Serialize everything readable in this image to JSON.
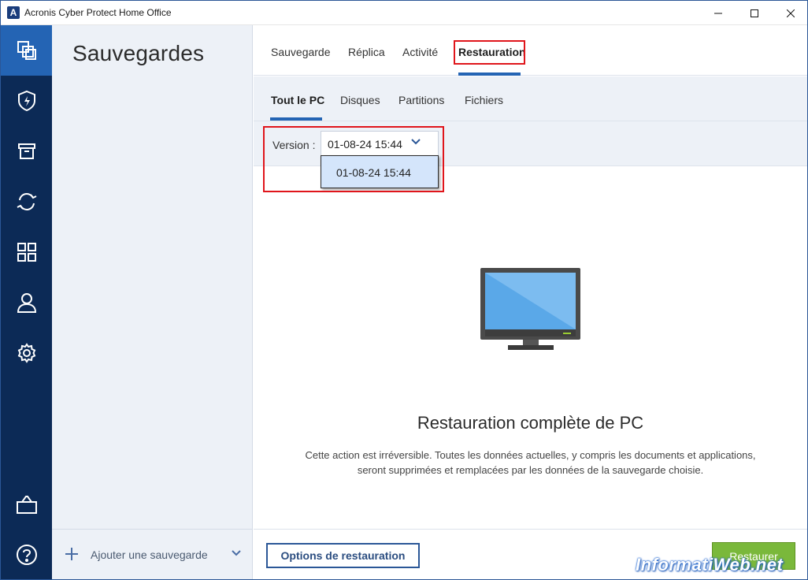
{
  "window": {
    "title": "Acronis Cyber Protect Home Office",
    "app_icon_letter": "A"
  },
  "rail": {
    "items": [
      {
        "icon": "backup-copies-icon",
        "active": true
      },
      {
        "icon": "shield-icon",
        "active": false
      },
      {
        "icon": "archive-icon",
        "active": false
      },
      {
        "icon": "sync-icon",
        "active": false
      },
      {
        "icon": "dashboard-grid-icon",
        "active": false
      },
      {
        "icon": "account-icon",
        "active": false
      },
      {
        "icon": "gear-icon",
        "active": false
      },
      {
        "icon": "shop-bag-icon",
        "active": false
      },
      {
        "icon": "help-icon",
        "active": false
      }
    ]
  },
  "sidebar": {
    "title": "Sauvegardes",
    "add_label": "Ajouter une sauvegarde"
  },
  "top_tabs": [
    {
      "label": "Sauvegarde",
      "active": false
    },
    {
      "label": "Réplica",
      "active": false
    },
    {
      "label": "Activité",
      "active": false
    },
    {
      "label": "Restauration",
      "active": true
    }
  ],
  "sub_tabs": [
    {
      "label": "Tout le PC",
      "active": true
    },
    {
      "label": "Disques",
      "active": false
    },
    {
      "label": "Partitions",
      "active": false
    },
    {
      "label": "Fichiers",
      "active": false
    }
  ],
  "version": {
    "label": "Version :",
    "selected": "01-08-24 15:44",
    "options": [
      "01-08-24 15:44"
    ]
  },
  "content": {
    "title": "Restauration complète de PC",
    "description": "Cette action est irréversible. Toutes les données actuelles, y compris les documents et applications, seront supprimées et remplacées par les données de la sauvegarde choisie."
  },
  "buttons": {
    "options": "Options de restauration",
    "restore": "Restaurer"
  },
  "watermark": "InformatiWeb.net",
  "colors": {
    "rail": "#0c2a56",
    "rail_active": "#2464b4",
    "accent": "#2464b4",
    "restore_button": "#7ab83b",
    "highlight_box": "#e0151b"
  }
}
